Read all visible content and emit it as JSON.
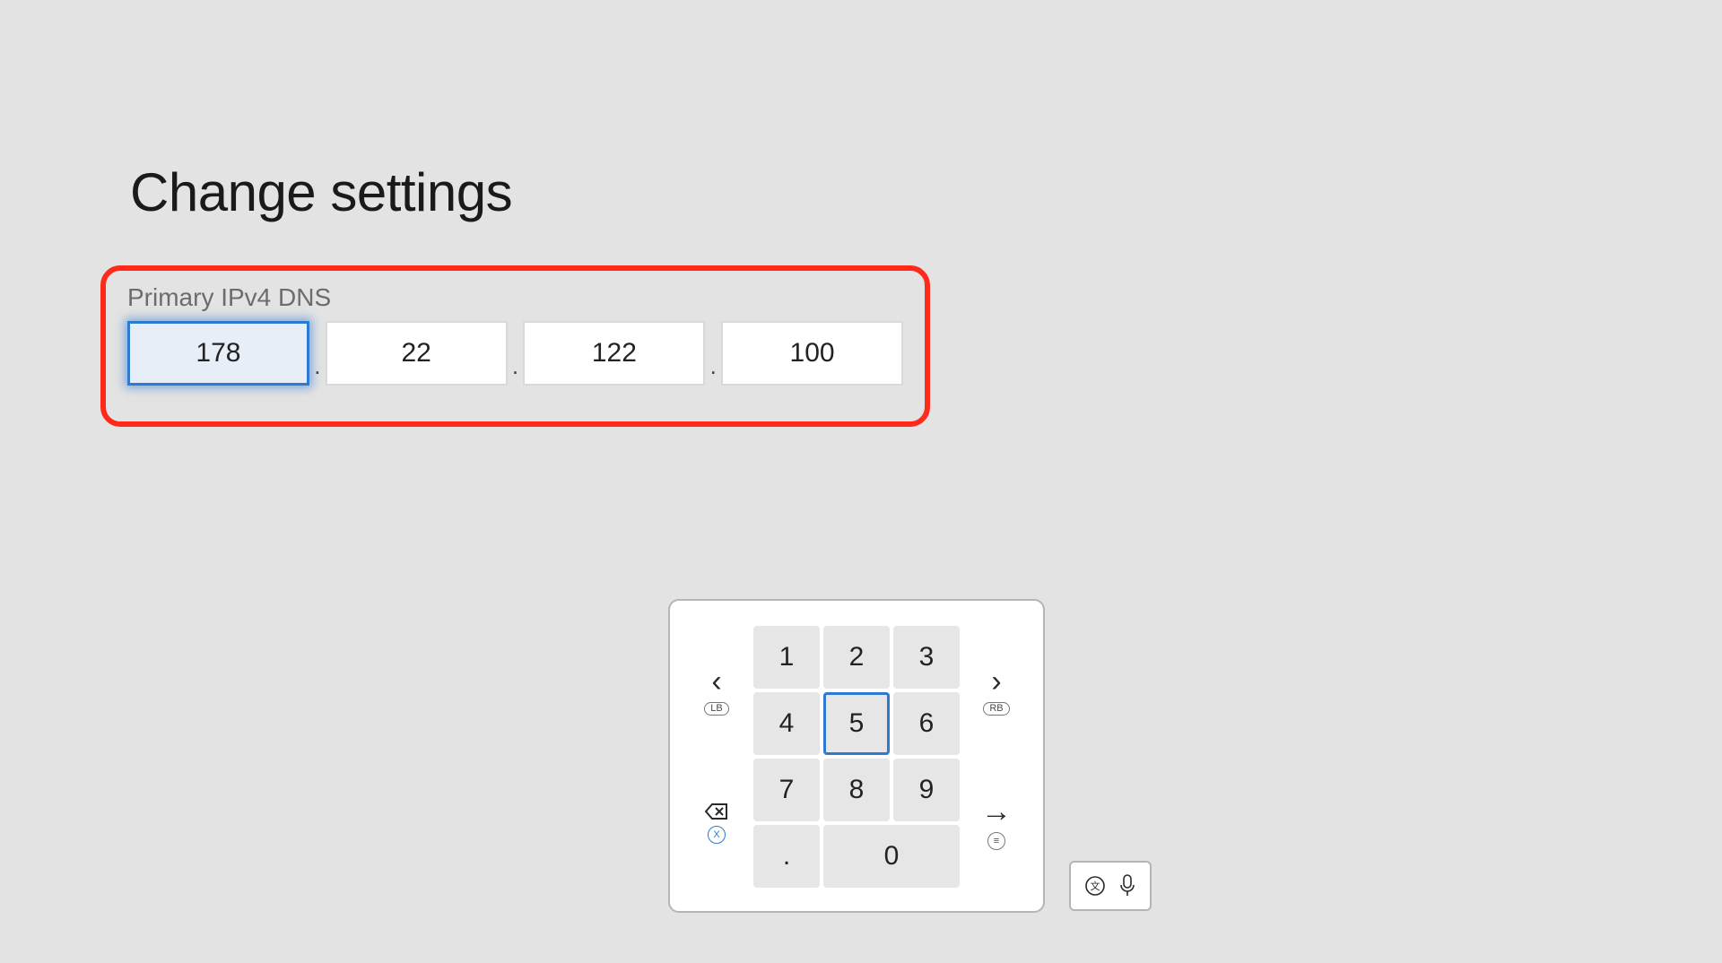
{
  "header": {
    "title": "Change settings"
  },
  "dns": {
    "label": "Primary IPv4 DNS",
    "octets": [
      "178",
      "22",
      "122",
      "100"
    ],
    "focused_index": 0
  },
  "keypad": {
    "keys": {
      "k1": "1",
      "k2": "2",
      "k3": "3",
      "k4": "4",
      "k5": "5",
      "k6": "6",
      "k7": "7",
      "k8": "8",
      "k9": "9",
      "kdot": ".",
      "k0": "0"
    },
    "selected": "k5",
    "left": {
      "shift_glyph": "‹",
      "bumper": "LB",
      "x_btn": "X"
    },
    "right": {
      "shift_glyph": "›",
      "bumper": "RB",
      "menu": "≡"
    },
    "enter_glyph": "→"
  },
  "mini_toolbar": {
    "lang_icon": "ⓖ",
    "mic_icon": "mic"
  }
}
